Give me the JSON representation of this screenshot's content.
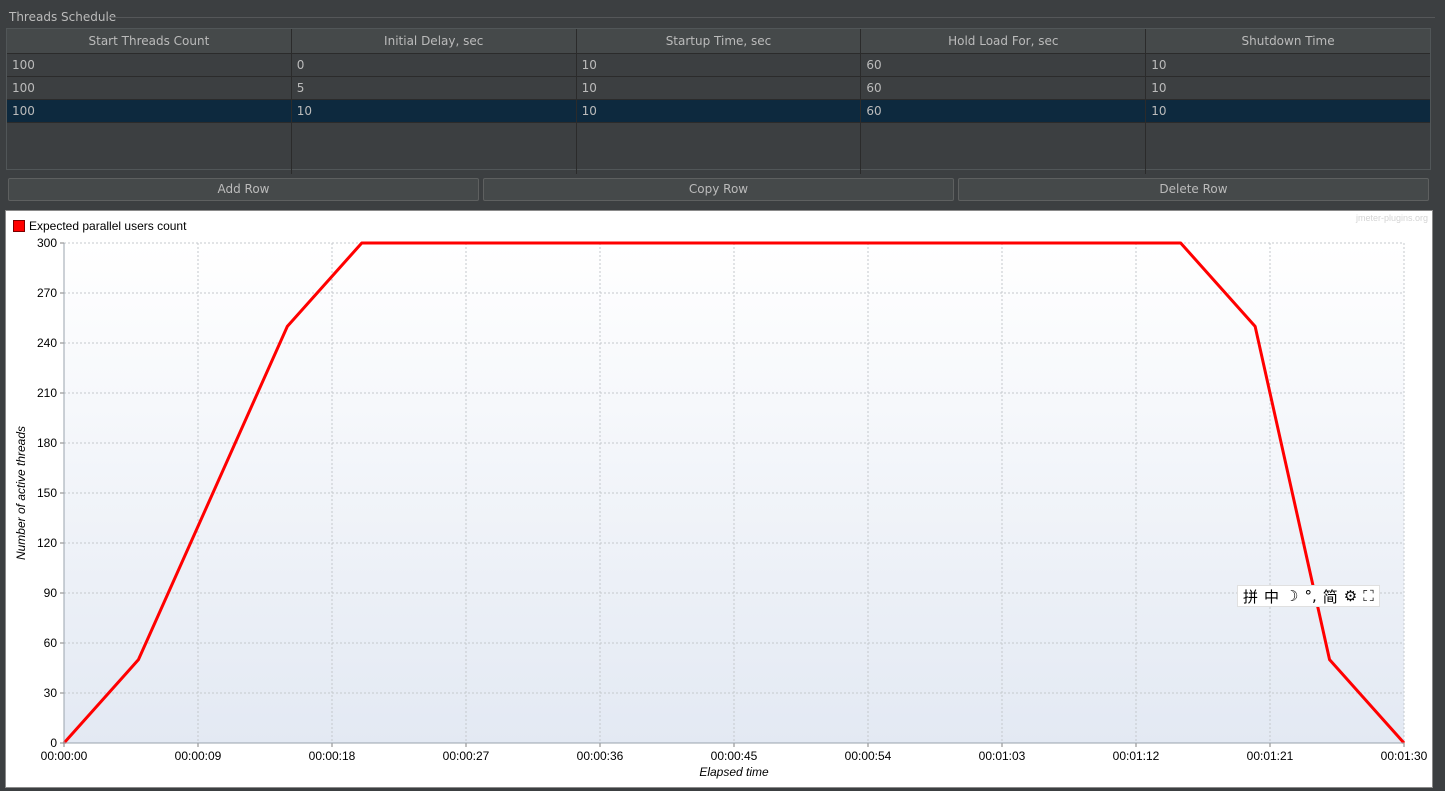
{
  "group": {
    "title": "Threads Schedule"
  },
  "table": {
    "headers": [
      "Start Threads Count",
      "Initial Delay, sec",
      "Startup Time, sec",
      "Hold Load For, sec",
      "Shutdown Time"
    ],
    "rows": [
      [
        "100",
        "0",
        "10",
        "60",
        "10"
      ],
      [
        "100",
        "5",
        "10",
        "60",
        "10"
      ],
      [
        "100",
        "10",
        "10",
        "60",
        "10"
      ]
    ],
    "selected_row": 2
  },
  "buttons": {
    "add": "Add Row",
    "copy": "Copy Row",
    "delete": "Delete Row"
  },
  "chart_watermark": "jmeter-plugins.org",
  "ime_toolbar": [
    "拼",
    "中",
    "☽",
    "°,",
    "简",
    "⚙",
    "⛶"
  ],
  "chart_data": {
    "type": "line",
    "series": [
      {
        "name": "Expected parallel users count",
        "color": "#ff0000",
        "x": [
          0,
          5,
          15,
          20,
          75,
          80,
          85,
          90
        ],
        "y": [
          0,
          50,
          250,
          300,
          300,
          250,
          50,
          0
        ]
      }
    ],
    "xlabel": "Elapsed time",
    "ylabel": "Number of active threads",
    "xlim": [
      0,
      90
    ],
    "ylim": [
      0,
      300
    ],
    "x_tick_values": [
      0,
      9,
      18,
      27,
      36,
      45,
      54,
      63,
      72,
      81,
      90
    ],
    "x_tick_labels": [
      "00:00:00",
      "00:00:09",
      "00:00:18",
      "00:00:27",
      "00:00:36",
      "00:00:45",
      "00:00:54",
      "00:01:03",
      "00:01:12",
      "00:01:21",
      "00:01:30"
    ],
    "y_ticks": [
      0,
      30,
      60,
      90,
      120,
      150,
      180,
      210,
      240,
      270,
      300
    ],
    "grid": true,
    "legend_position": "top-left"
  }
}
